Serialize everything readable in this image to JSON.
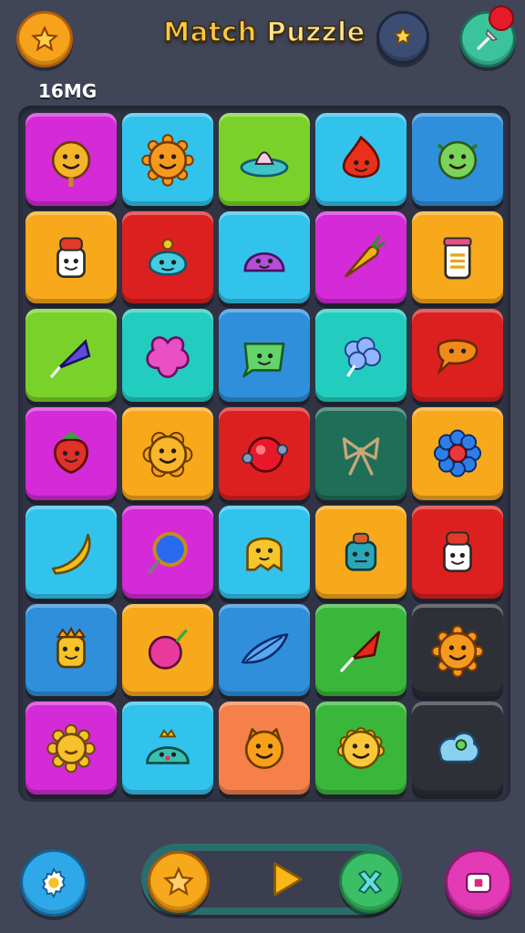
{
  "header": {
    "title_word1": "Match",
    "title_word2": "Puzzle",
    "left_button_icon": "star-icon",
    "center_button_icon": "star-badge-icon",
    "right_button_icon": "pin-icon"
  },
  "badge": {
    "text": "16MG"
  },
  "board": {
    "rows": 7,
    "cols": 5,
    "tiles": [
      [
        "magenta",
        "lollipop-face-icon"
      ],
      [
        "cyan",
        "sun-face-icon"
      ],
      [
        "lime",
        "fish-boat-icon"
      ],
      [
        "cyan",
        "flame-face-icon"
      ],
      [
        "blue",
        "alien-face-icon"
      ],
      [
        "orange",
        "chef-face-icon"
      ],
      [
        "red",
        "blob-face-icon"
      ],
      [
        "cyan",
        "slime-face-icon"
      ],
      [
        "magenta",
        "carrot-icon"
      ],
      [
        "orange",
        "jar-icon"
      ],
      [
        "lime",
        "umbrella-icon"
      ],
      [
        "teal",
        "star-cross-icon"
      ],
      [
        "blue",
        "speech-face-icon"
      ],
      [
        "teal",
        "cloud-flower-icon"
      ],
      [
        "red",
        "speech-bubble-icon"
      ],
      [
        "magenta",
        "strawberry-face-icon"
      ],
      [
        "orange",
        "flower-face-icon"
      ],
      [
        "red",
        "orb-icon"
      ],
      [
        "darkgreen",
        "bow-icon"
      ],
      [
        "orange",
        "flower-icon"
      ],
      [
        "cyan",
        "banana-icon"
      ],
      [
        "magenta",
        "mirror-icon"
      ],
      [
        "cyan",
        "ghost-face-icon"
      ],
      [
        "orange",
        "robot-face-icon"
      ],
      [
        "red",
        "chef-face-icon"
      ],
      [
        "blue",
        "king-face-icon"
      ],
      [
        "orange",
        "balloon-icon"
      ],
      [
        "blue",
        "leaf-fish-icon"
      ],
      [
        "green",
        "red-umbrella-icon"
      ],
      [
        "dark",
        "sun-face-icon"
      ],
      [
        "magenta",
        "sun-icon"
      ],
      [
        "cyan",
        "crown-slime-icon"
      ],
      [
        "salmon",
        "cat-face-icon"
      ],
      [
        "green",
        "spiky-face-icon"
      ],
      [
        "dark",
        "cloud-blob-icon"
      ]
    ]
  },
  "colors": {
    "magenta": "#d42ad8",
    "cyan": "#31c3ec",
    "lime": "#7ad12a",
    "blue": "#2f8fdb",
    "orange": "#f7a81b",
    "red": "#dc2020",
    "teal": "#22cdbf",
    "darkgreen": "#1f6f58",
    "green": "#3ab63a",
    "salmon": "#f5804a",
    "dark": "#2e3038"
  },
  "footer": {
    "settings_icon": "gear-icon",
    "star_icon": "star-icon",
    "play_icon": "play-icon",
    "close_icon": "cross-icon",
    "record_icon": "record-icon"
  }
}
